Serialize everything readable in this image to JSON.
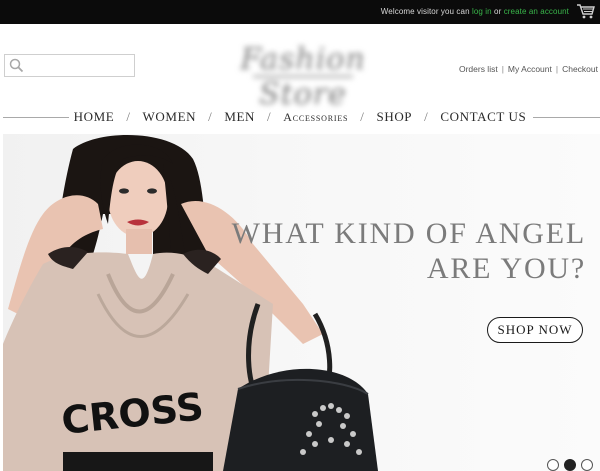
{
  "topbar": {
    "welcome_prefix": "Welcome visitor you can",
    "login_label": "log in",
    "or_text": "or",
    "create_account_label": "create an account",
    "link_color": "#39b54a",
    "cart_icon": "cart-icon"
  },
  "search": {
    "placeholder": "",
    "icon": "search-icon"
  },
  "logo": {
    "text": "Fashion Store"
  },
  "account_links": [
    {
      "label": "Orders list"
    },
    {
      "label": "My Account"
    },
    {
      "label": "Checkout"
    }
  ],
  "nav": {
    "items": [
      {
        "label": "HOME"
      },
      {
        "label": "WOMEN"
      },
      {
        "label": "MEN"
      },
      {
        "label": "Accessories"
      },
      {
        "label": "SHOP"
      },
      {
        "label": "CONTACT US"
      }
    ],
    "separator": "/"
  },
  "hero": {
    "headline_line1": "WHAT KIND OF ANGEL",
    "headline_line2": "ARE YOU?",
    "cta_label": "SHOP NOW",
    "shirt_text": "CROSS",
    "slides": 3,
    "active_slide": 2
  }
}
